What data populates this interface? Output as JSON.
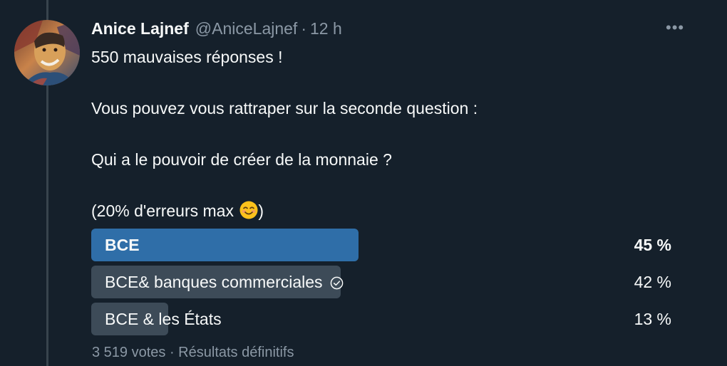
{
  "author": {
    "name": "Anice Lajnef",
    "handle": "@AniceLajnef",
    "separator": "·",
    "time": "12 h"
  },
  "tweet": {
    "line1": "550 mauvaises réponses !",
    "line2": "Vous pouvez vous rattraper sur la seconde question :",
    "line3": "Qui a le pouvoir de créer de la monnaie ?",
    "line4": "(20% d'erreurs max ",
    "line4_end": ")",
    "emoji_icon": "smiling-face-emoji"
  },
  "poll": {
    "options": [
      {
        "label": "BCE",
        "percent_text": "45 %",
        "percent": 45,
        "winner": true
      },
      {
        "label": "BCE& banques commerciales",
        "percent_text": "42 %",
        "percent": 42,
        "winner": false,
        "voted": true
      },
      {
        "label": "BCE & les États",
        "percent_text": "13 %",
        "percent": 13,
        "winner": false
      }
    ],
    "footer": "3 519 votes · Résultats définitifs"
  },
  "colors": {
    "background": "#15202b",
    "winner_bar": "#2f6ea8",
    "other_bar": "#3d4b58",
    "secondary_text": "#8b98a5"
  }
}
